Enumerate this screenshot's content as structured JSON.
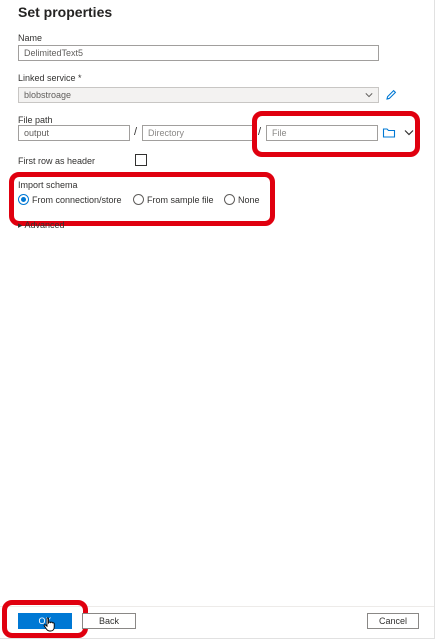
{
  "panel": {
    "title": "Set properties"
  },
  "name": {
    "label": "Name",
    "value": "DelimitedText5"
  },
  "linked_service": {
    "label": "Linked service *",
    "value": "blobstroage"
  },
  "file_path": {
    "label": "File path",
    "container_value": "output",
    "directory_placeholder": "Directory",
    "file_placeholder": "File",
    "separator": "/"
  },
  "first_row_header": {
    "label": "First row as header",
    "checked": false
  },
  "import_schema": {
    "label": "Import schema",
    "options": [
      {
        "label": "From connection/store",
        "selected": true
      },
      {
        "label": "From sample file",
        "selected": false
      },
      {
        "label": "None",
        "selected": false
      }
    ]
  },
  "advanced": {
    "label": "Advanced"
  },
  "footer": {
    "ok_label": "OK",
    "back_label": "Back",
    "cancel_label": "Cancel"
  },
  "colors": {
    "accent": "#0078d4",
    "highlight": "#e0000f"
  },
  "icons": [
    "pencil-icon",
    "folder-icon",
    "chevron-down-icon",
    "cursor-hand-icon"
  ]
}
